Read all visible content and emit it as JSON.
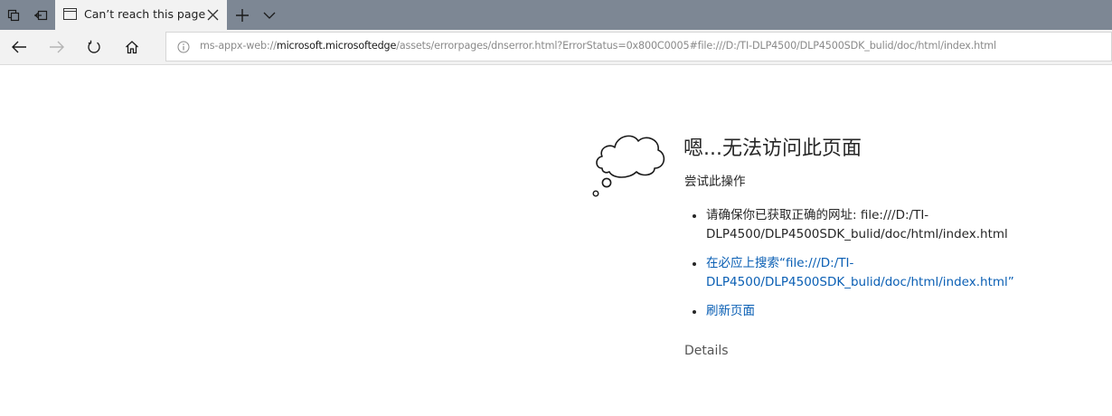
{
  "browser": {
    "tab": {
      "title": "Can’t reach this page"
    },
    "address": {
      "scheme": "ms-appx-web://",
      "host": "microsoft.microsoftedge",
      "path": "/assets/errorpages/dnserror.html?ErrorStatus=0x800C0005#file:///D:/TI-DLP4500/DLP4500SDK_bulid/doc/html/index.html"
    },
    "icons": {
      "tab_actions": "tab-actions-icon",
      "set_aside": "set-aside-icon",
      "new_tab": "plus-icon",
      "tab_preview": "chevron-down-icon",
      "back": "back-arrow-icon",
      "forward": "forward-arrow-icon",
      "refresh": "refresh-icon",
      "home": "home-icon",
      "site_info": "info-icon"
    },
    "colors": {
      "tabstrip": "#7d8794",
      "chrome": "#f2f2f2",
      "link": "#0a5fb4"
    }
  },
  "error_page": {
    "icon": "thought-cloud-icon",
    "title": "嗯...无法访问此页面",
    "subtitle": "尝试此操作",
    "suggestions": [
      {
        "line1": "请确保你已获取正确的网址: file:///D:/TI-",
        "line2": "DLP4500/DLP4500SDK_bulid/doc/html/index.html"
      },
      {
        "line1": "在必应上搜索“file:///D:/TI-",
        "line2": "DLP4500/DLP4500SDK_bulid/doc/html/index.html”"
      },
      {
        "line1": "刷新页面"
      }
    ],
    "details_label": "Details"
  }
}
